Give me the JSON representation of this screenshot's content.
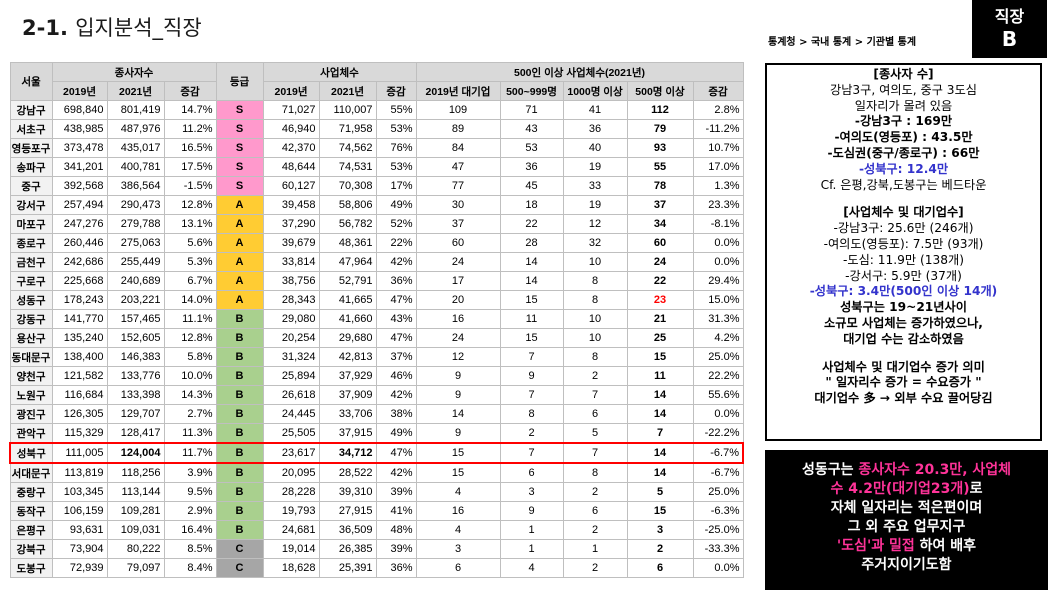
{
  "header": {
    "title_num": "2-1.",
    "title_text": "입지분석_직장",
    "source": "통계청 > 국내 통계 > 기관별 통계",
    "badge_line1": "직장",
    "badge_line2": "B"
  },
  "table": {
    "h_region": "서울",
    "h_employees": "종사자수",
    "h_grade": "등급",
    "h_businesses": "사업체수",
    "h_large": "500인 이상 사업체수(2021년)",
    "h_2019": "2019년",
    "h_2021": "2021년",
    "h_change": "증감",
    "h_large2019": "2019년 대기업",
    "h_500_999": "500~999명",
    "h_1000": "1000명 이상",
    "h_500plus": "500명 이상",
    "h_change2": "증감",
    "rows": [
      {
        "gu": "강남구",
        "e19": "698,840",
        "e21": "801,419",
        "ec": "14.7%",
        "grade": "S",
        "b19": "71,027",
        "b21": "110,007",
        "bc": "55%",
        "l19": "109",
        "l500": "71",
        "l1000": "41",
        "lall": "112",
        "lc": "2.8%"
      },
      {
        "gu": "서초구",
        "e19": "438,985",
        "e21": "487,976",
        "ec": "11.2%",
        "grade": "S",
        "b19": "46,940",
        "b21": "71,958",
        "bc": "53%",
        "l19": "89",
        "l500": "43",
        "l1000": "36",
        "lall": "79",
        "lc": "-11.2%"
      },
      {
        "gu": "영등포구",
        "e19": "373,478",
        "e21": "435,017",
        "ec": "16.5%",
        "grade": "S",
        "b19": "42,370",
        "b21": "74,562",
        "bc": "76%",
        "l19": "84",
        "l500": "53",
        "l1000": "40",
        "lall": "93",
        "lc": "10.7%"
      },
      {
        "gu": "송파구",
        "e19": "341,201",
        "e21": "400,781",
        "ec": "17.5%",
        "grade": "S",
        "b19": "48,644",
        "b21": "74,531",
        "bc": "53%",
        "l19": "47",
        "l500": "36",
        "l1000": "19",
        "lall": "55",
        "lc": "17.0%"
      },
      {
        "gu": "중구",
        "e19": "392,568",
        "e21": "386,564",
        "ec": "-1.5%",
        "grade": "S",
        "b19": "60,127",
        "b21": "70,308",
        "bc": "17%",
        "l19": "77",
        "l500": "45",
        "l1000": "33",
        "lall": "78",
        "lc": "1.3%"
      },
      {
        "gu": "강서구",
        "e19": "257,494",
        "e21": "290,473",
        "ec": "12.8%",
        "grade": "A",
        "b19": "39,458",
        "b21": "58,806",
        "bc": "49%",
        "l19": "30",
        "l500": "18",
        "l1000": "19",
        "lall": "37",
        "lc": "23.3%"
      },
      {
        "gu": "마포구",
        "e19": "247,276",
        "e21": "279,788",
        "ec": "13.1%",
        "grade": "A",
        "b19": "37,290",
        "b21": "56,782",
        "bc": "52%",
        "l19": "37",
        "l500": "22",
        "l1000": "12",
        "lall": "34",
        "lc": "-8.1%"
      },
      {
        "gu": "종로구",
        "e19": "260,446",
        "e21": "275,063",
        "ec": "5.6%",
        "grade": "A",
        "b19": "39,679",
        "b21": "48,361",
        "bc": "22%",
        "l19": "60",
        "l500": "28",
        "l1000": "32",
        "lall": "60",
        "lc": "0.0%"
      },
      {
        "gu": "금천구",
        "e19": "242,686",
        "e21": "255,449",
        "ec": "5.3%",
        "grade": "A",
        "b19": "33,814",
        "b21": "47,964",
        "bc": "42%",
        "l19": "24",
        "l500": "14",
        "l1000": "10",
        "lall": "24",
        "lc": "0.0%"
      },
      {
        "gu": "구로구",
        "e19": "225,668",
        "e21": "240,689",
        "ec": "6.7%",
        "grade": "A",
        "b19": "38,756",
        "b21": "52,791",
        "bc": "36%",
        "l19": "17",
        "l500": "14",
        "l1000": "8",
        "lall": "22",
        "lc": "29.4%"
      },
      {
        "gu": "성동구",
        "e19": "178,243",
        "e21": "203,221",
        "ec": "14.0%",
        "grade": "A",
        "b19": "28,343",
        "b21": "41,665",
        "bc": "47%",
        "l19": "20",
        "l500": "15",
        "l1000": "8",
        "lall": "23",
        "lc": "15.0%"
      },
      {
        "gu": "강동구",
        "e19": "141,770",
        "e21": "157,465",
        "ec": "11.1%",
        "grade": "B",
        "b19": "29,080",
        "b21": "41,660",
        "bc": "43%",
        "l19": "16",
        "l500": "11",
        "l1000": "10",
        "lall": "21",
        "lc": "31.3%"
      },
      {
        "gu": "용산구",
        "e19": "135,240",
        "e21": "152,605",
        "ec": "12.8%",
        "grade": "B",
        "b19": "20,254",
        "b21": "29,680",
        "bc": "47%",
        "l19": "24",
        "l500": "15",
        "l1000": "10",
        "lall": "25",
        "lc": "4.2%"
      },
      {
        "gu": "동대문구",
        "e19": "138,400",
        "e21": "146,383",
        "ec": "5.8%",
        "grade": "B",
        "b19": "31,324",
        "b21": "42,813",
        "bc": "37%",
        "l19": "12",
        "l500": "7",
        "l1000": "8",
        "lall": "15",
        "lc": "25.0%"
      },
      {
        "gu": "양천구",
        "e19": "121,582",
        "e21": "133,776",
        "ec": "10.0%",
        "grade": "B",
        "b19": "25,894",
        "b21": "37,929",
        "bc": "46%",
        "l19": "9",
        "l500": "9",
        "l1000": "2",
        "lall": "11",
        "lc": "22.2%"
      },
      {
        "gu": "노원구",
        "e19": "116,684",
        "e21": "133,398",
        "ec": "14.3%",
        "grade": "B",
        "b19": "26,618",
        "b21": "37,909",
        "bc": "42%",
        "l19": "9",
        "l500": "7",
        "l1000": "7",
        "lall": "14",
        "lc": "55.6%"
      },
      {
        "gu": "광진구",
        "e19": "126,305",
        "e21": "129,707",
        "ec": "2.7%",
        "grade": "B",
        "b19": "24,445",
        "b21": "33,706",
        "bc": "38%",
        "l19": "14",
        "l500": "8",
        "l1000": "6",
        "lall": "14",
        "lc": "0.0%"
      },
      {
        "gu": "관악구",
        "e19": "115,329",
        "e21": "128,417",
        "ec": "11.3%",
        "grade": "B",
        "b19": "25,505",
        "b21": "37,915",
        "bc": "49%",
        "l19": "9",
        "l500": "2",
        "l1000": "5",
        "lall": "7",
        "lc": "-22.2%"
      },
      {
        "gu": "성북구",
        "e19": "111,005",
        "e21": "124,004",
        "ec": "11.7%",
        "grade": "B",
        "b19": "23,617",
        "b21": "34,712",
        "bc": "47%",
        "l19": "15",
        "l500": "7",
        "l1000": "7",
        "lall": "14",
        "lc": "-6.7%"
      },
      {
        "gu": "서대문구",
        "e19": "113,819",
        "e21": "118,256",
        "ec": "3.9%",
        "grade": "B",
        "b19": "20,095",
        "b21": "28,522",
        "bc": "42%",
        "l19": "15",
        "l500": "6",
        "l1000": "8",
        "lall": "14",
        "lc": "-6.7%"
      },
      {
        "gu": "중랑구",
        "e19": "103,345",
        "e21": "113,144",
        "ec": "9.5%",
        "grade": "B",
        "b19": "28,228",
        "b21": "39,310",
        "bc": "39%",
        "l19": "4",
        "l500": "3",
        "l1000": "2",
        "lall": "5",
        "lc": "25.0%"
      },
      {
        "gu": "동작구",
        "e19": "106,159",
        "e21": "109,281",
        "ec": "2.9%",
        "grade": "B",
        "b19": "19,793",
        "b21": "27,915",
        "bc": "41%",
        "l19": "16",
        "l500": "9",
        "l1000": "6",
        "lall": "15",
        "lc": "-6.3%"
      },
      {
        "gu": "은평구",
        "e19": "93,631",
        "e21": "109,031",
        "ec": "16.4%",
        "grade": "B",
        "b19": "24,681",
        "b21": "36,509",
        "bc": "48%",
        "l19": "4",
        "l500": "1",
        "l1000": "2",
        "lall": "3",
        "lc": "-25.0%"
      },
      {
        "gu": "강북구",
        "e19": "73,904",
        "e21": "80,222",
        "ec": "8.5%",
        "grade": "C",
        "b19": "19,014",
        "b21": "26,385",
        "bc": "39%",
        "l19": "3",
        "l500": "1",
        "l1000": "1",
        "lall": "2",
        "lc": "-33.3%"
      },
      {
        "gu": "도봉구",
        "e19": "72,939",
        "e21": "79,097",
        "ec": "8.4%",
        "grade": "C",
        "b19": "18,628",
        "b21": "25,391",
        "bc": "36%",
        "l19": "6",
        "l500": "4",
        "l1000": "2",
        "lall": "6",
        "lc": "0.0%"
      }
    ]
  },
  "notes": {
    "n1": "[종사자 수]",
    "n2": "강남3구, 여의도, 중구 3도심",
    "n3": "일자리가 몰려 있음",
    "n4": "-강남3구 : 169만",
    "n5": "-여의도(영등포) : 43.5만",
    "n6": "-도심권(중구/종로구) : 66만",
    "n7": "-성북구: 12.4만",
    "n8": "Cf. 은평,강북,도봉구는 베드타운",
    "n9": "[사업체수 및 대기업수]",
    "n10": "-강남3구: 25.6만 (246개)",
    "n11": "-여의도(영등포): 7.5만 (93개)",
    "n12": "-도심: 11.9만 (138개)",
    "n13": "-강서구: 5.9만 (37개)",
    "n14": "-성북구: 3.4만(500인 이상 14개)",
    "n15": "성북구는 19~21년사이",
    "n16": "소규모 사업체는 증가하였으나,",
    "n17": "대기업 수는 감소하였음",
    "n18": "사업체수 및 대기업수 증가 의미",
    "n19": "\" 일자리수 증가 = 수요증가 \"",
    "n20": "대기업수 多 → 외부 수요 끌어당김"
  },
  "summary": {
    "s1a": "성동구는 ",
    "s1b": "종사자수 20.3만, 사업체",
    "s2a": "수 4.2만(대기업23개)",
    "s2b": "로",
    "s3": "자체 일자리는 적은편이며",
    "s4": "그 외 주요 업무지구",
    "s5a": "'도심'과 밀접",
    "s5b": " 하여 배후",
    "s6": "주거지이기도함"
  },
  "colors": {
    "grade_S": "#ff99cc",
    "grade_A": "#ffcc33",
    "grade_B": "#a9d08e",
    "grade_C": "#a6a6a6",
    "highlight": "#ff0000",
    "accent_pink": "#ff3399",
    "accent_blue": "#3333cc"
  }
}
